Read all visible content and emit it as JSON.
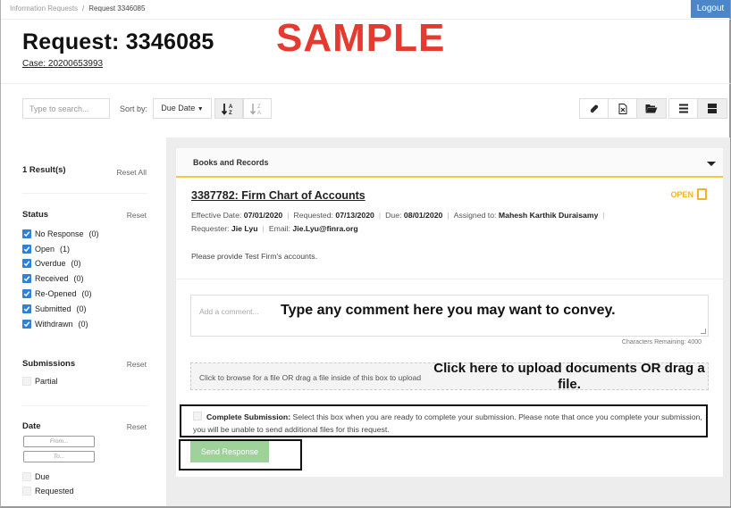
{
  "breadcrumb": {
    "items": [
      "Information Requests",
      "Request 3346085"
    ],
    "separator": "/"
  },
  "header": {
    "logout_label": "Logout",
    "title": "Request: 3346085",
    "case_link": "Case: 20200653993",
    "watermark": "SAMPLE"
  },
  "toolbar": {
    "search_placeholder": "Type to search...",
    "sort_label": "Sort by:",
    "sort_value": "Due Date",
    "sort_asc_icon": "sort-alpha-asc-icon",
    "sort_desc_icon": "sort-alpha-desc-icon",
    "action_icons": [
      "paperclip-icon",
      "excel-file-icon",
      "folder-open-icon"
    ],
    "view_icons": [
      "list-view-icon",
      "card-view-icon"
    ]
  },
  "sidebar": {
    "results": "1 Result(s)",
    "reset_all": "Reset All",
    "status": {
      "heading": "Status",
      "reset": "Reset",
      "items": [
        {
          "label": "No Response",
          "count": "(0)",
          "checked": true
        },
        {
          "label": "Open",
          "count": "(1)",
          "checked": true
        },
        {
          "label": "Overdue",
          "count": "(0)",
          "checked": true
        },
        {
          "label": "Received",
          "count": "(0)",
          "checked": true
        },
        {
          "label": "Re-Opened",
          "count": "(0)",
          "checked": true
        },
        {
          "label": "Submitted",
          "count": "(0)",
          "checked": true
        },
        {
          "label": "Withdrawn",
          "count": "(0)",
          "checked": true
        }
      ]
    },
    "submissions": {
      "heading": "Submissions",
      "reset": "Reset",
      "items": [
        {
          "label": "Partial",
          "checked": false
        }
      ]
    },
    "date": {
      "heading": "Date",
      "reset": "Reset",
      "from_placeholder": "From...",
      "to_placeholder": "To...",
      "items": [
        {
          "label": "Due",
          "checked": false
        },
        {
          "label": "Requested",
          "checked": false
        }
      ]
    }
  },
  "panel": {
    "header": "Books and Records",
    "request_title": "3387782: Firm Chart of Accounts",
    "status": "OPEN",
    "accent_color": "#f5c842",
    "meta": {
      "effective_date_label": "Effective Date:",
      "effective_date": "07/01/2020",
      "requested_label": "Requested:",
      "requested": "07/13/2020",
      "due_label": "Due:",
      "due": "08/01/2020",
      "assigned_label": "Assigned to:",
      "assigned": "Mahesh Karthik Duraisamy",
      "requester_label": "Requester:",
      "requester": "Jie Lyu",
      "email_label": "Email:",
      "email": "Jie.Lyu@finra.org"
    },
    "description": "Please provide Test Firm's accounts.",
    "comment_placeholder": "Add a comment...",
    "comment_annotation": "Type any comment here you may want to convey.",
    "chars_remaining": "Characters Remaining: 4000",
    "upload_text": "Click to browse for a file OR drag a file inside of this box to upload",
    "upload_annotation": "Click here to upload documents OR drag a file.",
    "complete_label": "Complete Submission:",
    "complete_text": "Select this box when you are ready to complete your submission. Please note that once you complete your submission, you will be unable to send additional files for this request.",
    "complete_checked": false,
    "send_label": "Send Response"
  }
}
